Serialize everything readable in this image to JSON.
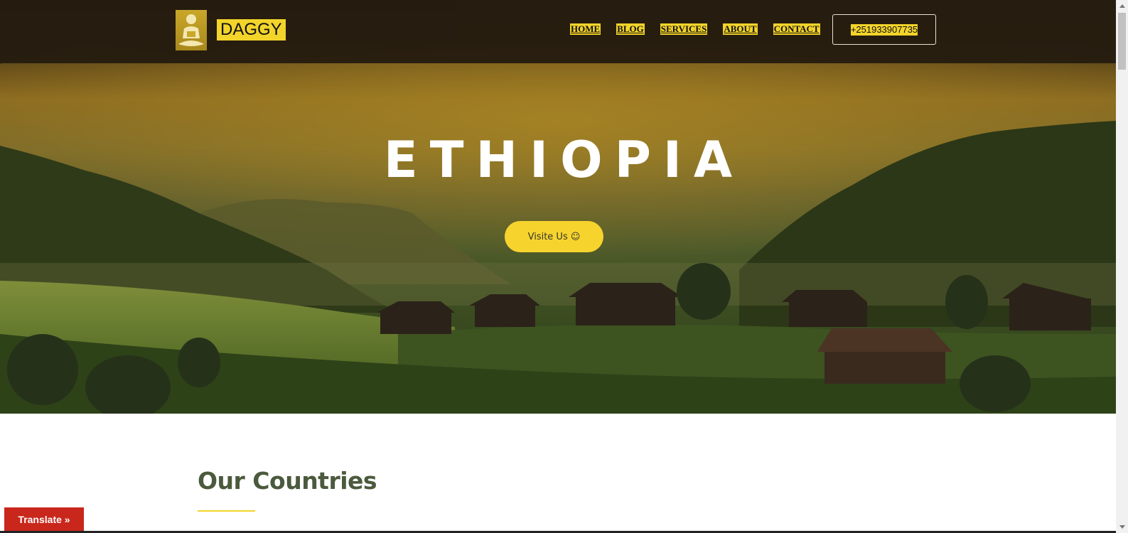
{
  "header": {
    "logo_text": "DAGGY",
    "nav": [
      "HOME",
      "BLOG",
      "SERVICES",
      "ABOUT",
      "CONTACT"
    ],
    "phone": "+251933907735"
  },
  "hero": {
    "title": "ETHIOPIA",
    "button_label": "Visite Us ☺"
  },
  "countries": {
    "title": "Our Countries"
  },
  "translate": {
    "label": "Translate »"
  },
  "colors": {
    "accent_yellow": "#f3d42a",
    "header_bg": "#251c10",
    "section_title": "#4b5a3c",
    "translate_red": "#c9271c"
  },
  "icons": {
    "logo": "person-meditating-logo",
    "scroll_up": "triangle-up-icon",
    "scroll_down": "triangle-down-icon"
  }
}
